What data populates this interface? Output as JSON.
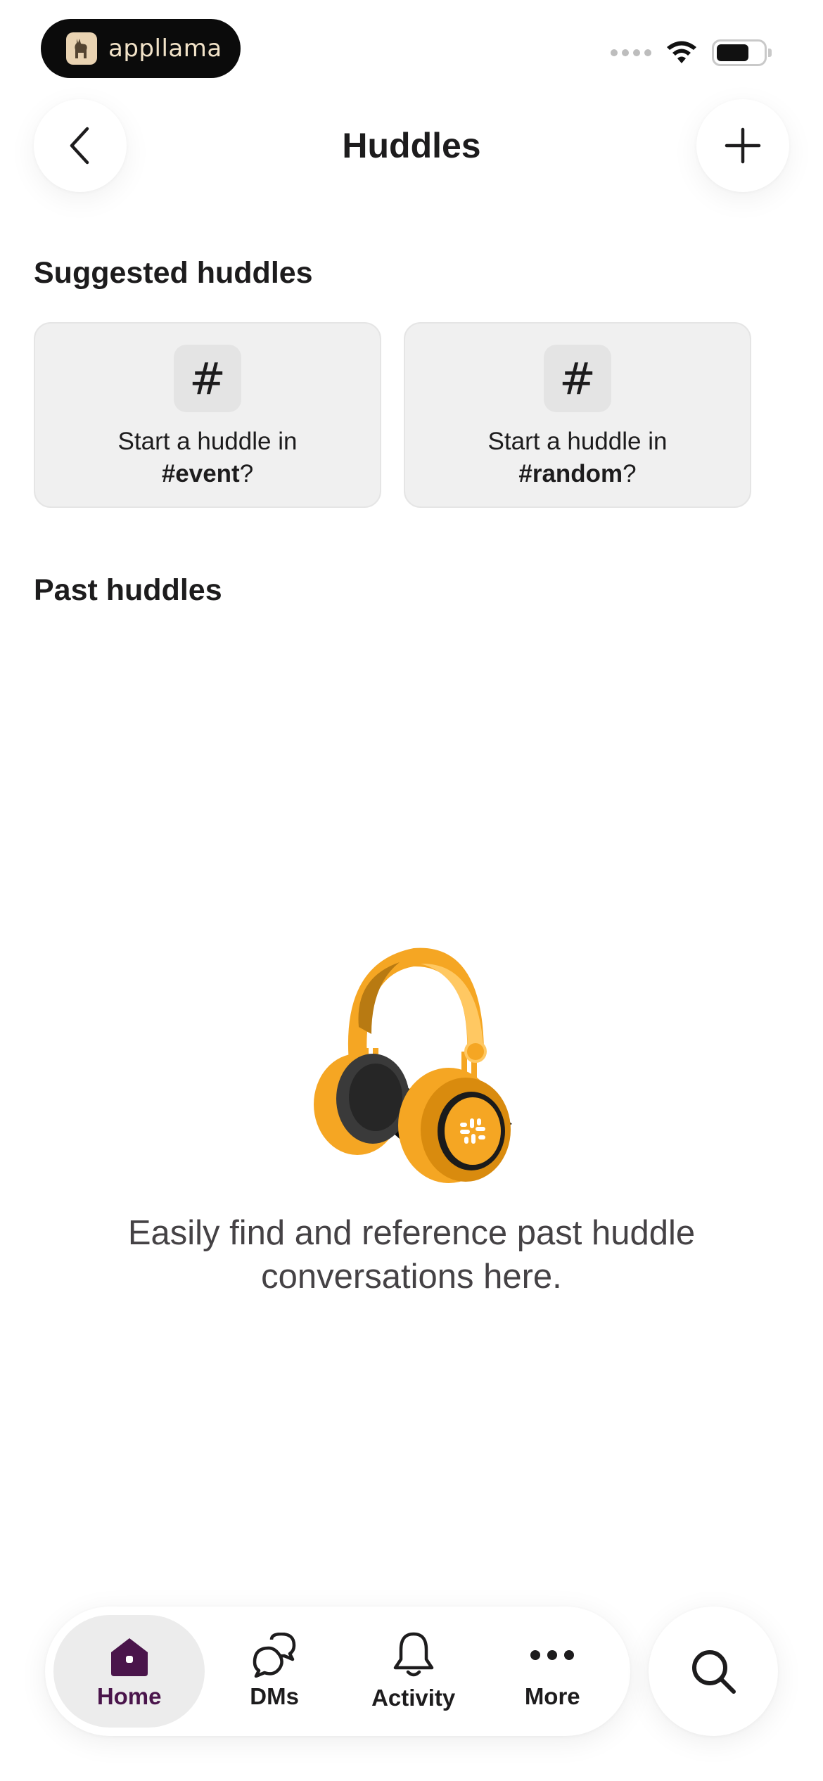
{
  "status_bar": {
    "brand": "appllama",
    "icons": [
      "signal-dots-icon",
      "wifi-icon",
      "battery-icon"
    ],
    "battery_level": 0.7
  },
  "header": {
    "title": "Huddles",
    "back_icon": "chevron-left-icon",
    "add_icon": "plus-icon"
  },
  "suggested": {
    "title": "Suggested huddles",
    "cards": [
      {
        "icon": "#",
        "prefix": "Start a huddle in",
        "channel": "#event",
        "suffix": "?"
      },
      {
        "icon": "#",
        "prefix": "Start a huddle in",
        "channel": "#random",
        "suffix": "?"
      }
    ]
  },
  "past": {
    "title": "Past huddles",
    "empty_icon": "headphones-illustration",
    "empty_message": "Easily find and reference past huddle conversations here."
  },
  "nav": {
    "items": [
      {
        "label": "Home",
        "icon": "home-icon",
        "active": true
      },
      {
        "label": "DMs",
        "icon": "dms-icon",
        "active": false
      },
      {
        "label": "Activity",
        "icon": "bell-icon",
        "active": false
      },
      {
        "label": "More",
        "icon": "more-dots-icon",
        "active": false
      }
    ],
    "search_icon": "search-icon"
  },
  "colors": {
    "accent": "#4a154b",
    "card_bg": "#f0f0f0",
    "headphone_orange": "#f5a623"
  }
}
